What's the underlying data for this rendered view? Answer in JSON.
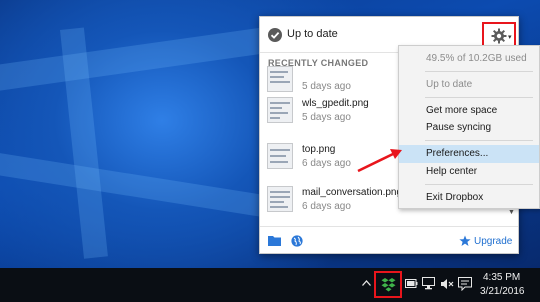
{
  "popup": {
    "status": "Up to date",
    "section_title": "RECENTLY CHANGED",
    "files": [
      {
        "name": "",
        "age": "5 days ago"
      },
      {
        "name": "wls_gpedit.png",
        "age": "5 days ago"
      },
      {
        "name": "top.png",
        "age": "6 days ago"
      },
      {
        "name": "mail_conversation.png",
        "age": "6 days ago"
      }
    ],
    "upgrade_label": "Upgrade",
    "icons": [
      "check-icon",
      "gear-icon",
      "folder-icon",
      "globe-icon",
      "star-icon",
      "chevron-down-icon"
    ]
  },
  "menu": {
    "usage": "49.5% of 10.2GB used",
    "status": "Up to date",
    "get_more_space": "Get more space",
    "pause_syncing": "Pause syncing",
    "preferences": "Preferences...",
    "help_center": "Help center",
    "exit": "Exit Dropbox"
  },
  "taskbar": {
    "time": "4:35 PM",
    "date": "3/21/2016",
    "icons": [
      "chevron-up-icon",
      "dropbox-icon",
      "battery-icon",
      "network-icon",
      "volume-mute-icon",
      "notification-icon"
    ]
  },
  "colors": {
    "highlight_box": "#e8151c",
    "link": "#1f6fd0",
    "menu_highlight": "#cbe3f6"
  }
}
